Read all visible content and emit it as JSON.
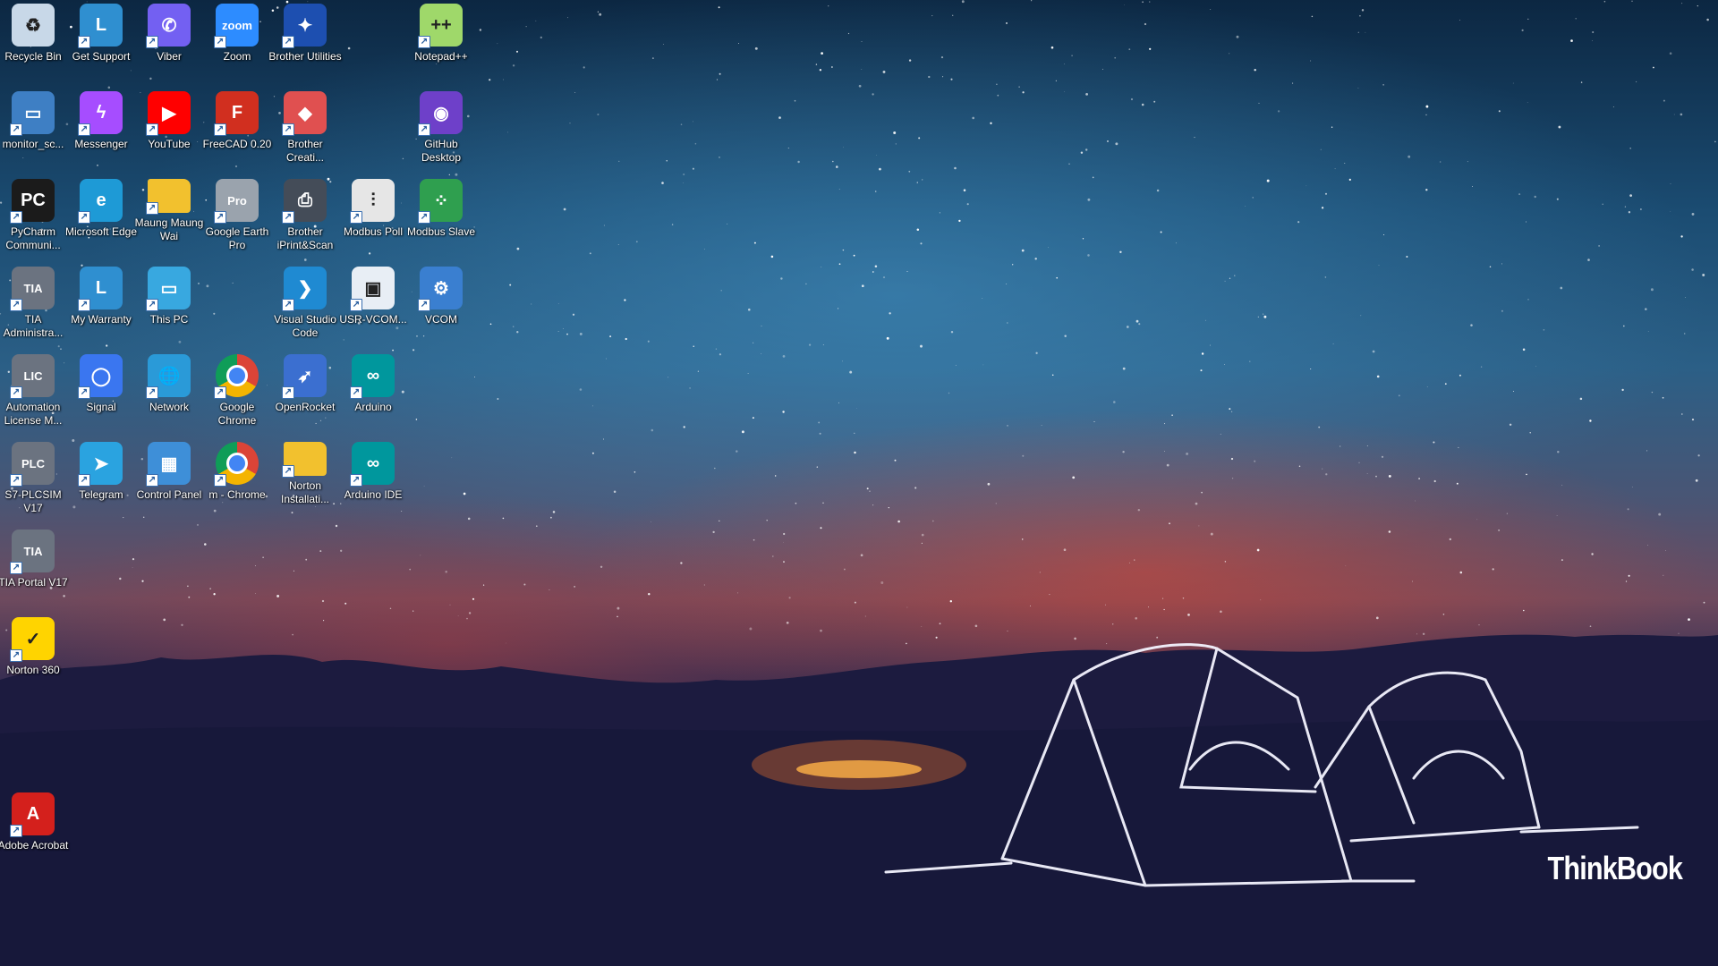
{
  "desktop": {
    "brand": "ThinkBook",
    "icons": [
      {
        "label": "Recycle Bin",
        "icon": "recycle-bin-icon",
        "color": "#c8d8e8",
        "glyph": "♻"
      },
      {
        "label": "Get Support",
        "icon": "get-support-icon",
        "color": "#2f8fd0",
        "glyph": "L"
      },
      {
        "label": "Viber",
        "icon": "viber-icon",
        "color": "#7360f2",
        "glyph": "✆"
      },
      {
        "label": "Zoom",
        "icon": "zoom-icon",
        "color": "#2d8cff",
        "glyph": "zoom"
      },
      {
        "label": "Brother Utilities",
        "icon": "brother-utilities-icon",
        "color": "#1d4fb0",
        "glyph": "✦"
      },
      {
        "label": "Notepad++",
        "icon": "notepad-plus-plus-icon",
        "color": "#9fd86a",
        "glyph": "++"
      },
      {
        "label": "monitor_sc...",
        "icon": "monitor-screenshot-icon",
        "color": "#3e7fc4",
        "glyph": "▭"
      },
      {
        "label": "Messenger",
        "icon": "messenger-icon",
        "color": "#a64dff",
        "glyph": "ϟ"
      },
      {
        "label": "YouTube",
        "icon": "youtube-icon",
        "color": "#ff0000",
        "glyph": "▶"
      },
      {
        "label": "FreeCAD 0.20",
        "icon": "freecad-icon",
        "color": "#d12f1f",
        "glyph": "F"
      },
      {
        "label": "Brother Creati...",
        "icon": "brother-creative-icon",
        "color": "#e05050",
        "glyph": "◆"
      },
      {
        "label": "GitHub Desktop",
        "icon": "github-desktop-icon",
        "color": "#6e40c9",
        "glyph": "◉"
      },
      {
        "label": "PyCharm Communi...",
        "icon": "pycharm-icon",
        "color": "#1b1b1b",
        "glyph": "PC"
      },
      {
        "label": "Microsoft Edge",
        "icon": "microsoft-edge-icon",
        "color": "#1e9ad6",
        "glyph": "e"
      },
      {
        "label": "Maung Maung Wai",
        "icon": "folder-icon",
        "color": "#f2c12e",
        "glyph": ""
      },
      {
        "label": "Google Earth Pro",
        "icon": "google-earth-pro-icon",
        "color": "#9aa3ad",
        "glyph": "Pro"
      },
      {
        "label": "Brother iPrint&Scan",
        "icon": "brother-iprint-scan-icon",
        "color": "#444c58",
        "glyph": "⎙"
      },
      {
        "label": "Modbus Poll",
        "icon": "modbus-poll-icon",
        "color": "#e6e6e6",
        "glyph": "⫶"
      },
      {
        "label": "Modbus Slave",
        "icon": "modbus-slave-icon",
        "color": "#2f9f4f",
        "glyph": "⁘"
      },
      {
        "label": "TIA Administra...",
        "icon": "tia-admin-icon",
        "color": "#6b7380",
        "glyph": "TIA"
      },
      {
        "label": "My Warranty",
        "icon": "my-warranty-icon",
        "color": "#2f8fd0",
        "glyph": "L"
      },
      {
        "label": "This PC",
        "icon": "this-pc-icon",
        "color": "#38a8e0",
        "glyph": "▭"
      },
      {
        "label": "Visual Studio Code",
        "icon": "vscode-icon",
        "color": "#1f8ad2",
        "glyph": "❯"
      },
      {
        "label": "USR-VCOM...",
        "icon": "usr-vcom-icon",
        "color": "#e8eef5",
        "glyph": "▣"
      },
      {
        "label": "VCOM",
        "icon": "vcom-icon",
        "color": "#3a7fd0",
        "glyph": "⚙"
      },
      {
        "label": "Automation License M...",
        "icon": "automation-license-icon",
        "color": "#6b7380",
        "glyph": "LIC"
      },
      {
        "label": "Signal",
        "icon": "signal-icon",
        "color": "#3a76f0",
        "glyph": "◯"
      },
      {
        "label": "Network",
        "icon": "network-icon",
        "color": "#2a9ad8",
        "glyph": "🌐"
      },
      {
        "label": "Google Chrome",
        "icon": "google-chrome-icon",
        "color": "#ffffff",
        "glyph": ""
      },
      {
        "label": "OpenRocket",
        "icon": "openrocket-icon",
        "color": "#3b6fd0",
        "glyph": "➶"
      },
      {
        "label": "Arduino",
        "icon": "arduino-icon",
        "color": "#00979d",
        "glyph": "∞"
      },
      {
        "label": "S7-PLCSIM V17",
        "icon": "plcsim-icon",
        "color": "#6b7380",
        "glyph": "PLC"
      },
      {
        "label": "Telegram",
        "icon": "telegram-icon",
        "color": "#2aa3e0",
        "glyph": "➤"
      },
      {
        "label": "Control Panel",
        "icon": "control-panel-icon",
        "color": "#3e8fd8",
        "glyph": "▦"
      },
      {
        "label": "m - Chrome",
        "icon": "chrome-profile-icon",
        "color": "#ffffff",
        "glyph": ""
      },
      {
        "label": "Norton Installati...",
        "icon": "folder-icon",
        "color": "#f2c12e",
        "glyph": ""
      },
      {
        "label": "Arduino IDE",
        "icon": "arduino-ide-icon",
        "color": "#00979d",
        "glyph": "∞"
      },
      {
        "label": "TIA Portal V17",
        "icon": "tia-portal-icon",
        "color": "#6b7380",
        "glyph": "TIA"
      },
      {
        "label": "Norton 360",
        "icon": "norton-360-icon",
        "color": "#ffd400",
        "glyph": "✓"
      },
      {
        "label": "Adobe Acrobat",
        "icon": "adobe-acrobat-icon",
        "color": "#d4201c",
        "glyph": "A"
      }
    ]
  }
}
